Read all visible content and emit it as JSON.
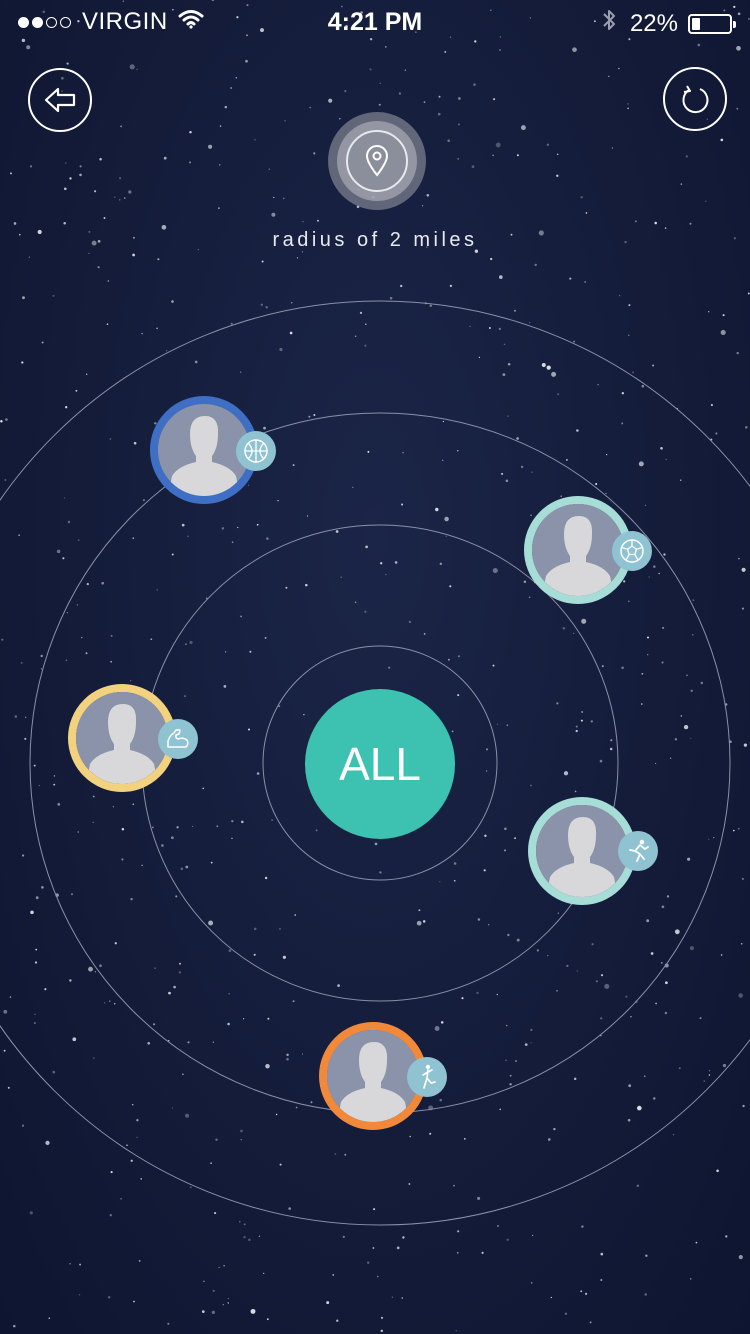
{
  "status_bar": {
    "carrier": "VIRGIN",
    "signal_filled": 2,
    "signal_total": 4,
    "time": "4:21 PM",
    "battery_text": "22%",
    "battery_level": 0.22
  },
  "header": {
    "back_icon": "back-arrow-icon",
    "refresh_icon": "refresh-icon",
    "location_icon": "location-pin-icon",
    "radius_label": "radius of 2 miles"
  },
  "center_button": {
    "label": "ALL",
    "color": "#3dc1b0"
  },
  "users": [
    {
      "sport": "basketball",
      "sport_icon": "basketball-icon",
      "ring_color": "#3f6fc4"
    },
    {
      "sport": "soccer",
      "sport_icon": "soccer-ball-icon",
      "ring_color": "#a6ddd6"
    },
    {
      "sport": "strength",
      "sport_icon": "flexed-arm-icon",
      "ring_color": "#f2d27e"
    },
    {
      "sport": "running",
      "sport_icon": "runner-icon",
      "ring_color": "#a6ddd6"
    },
    {
      "sport": "kicking",
      "sport_icon": "kicker-icon",
      "ring_color": "#f2893a"
    }
  ],
  "colors": {
    "background": "#141c3a",
    "ring_lines": "#8a90a8",
    "badge": "#8fc3d1"
  }
}
